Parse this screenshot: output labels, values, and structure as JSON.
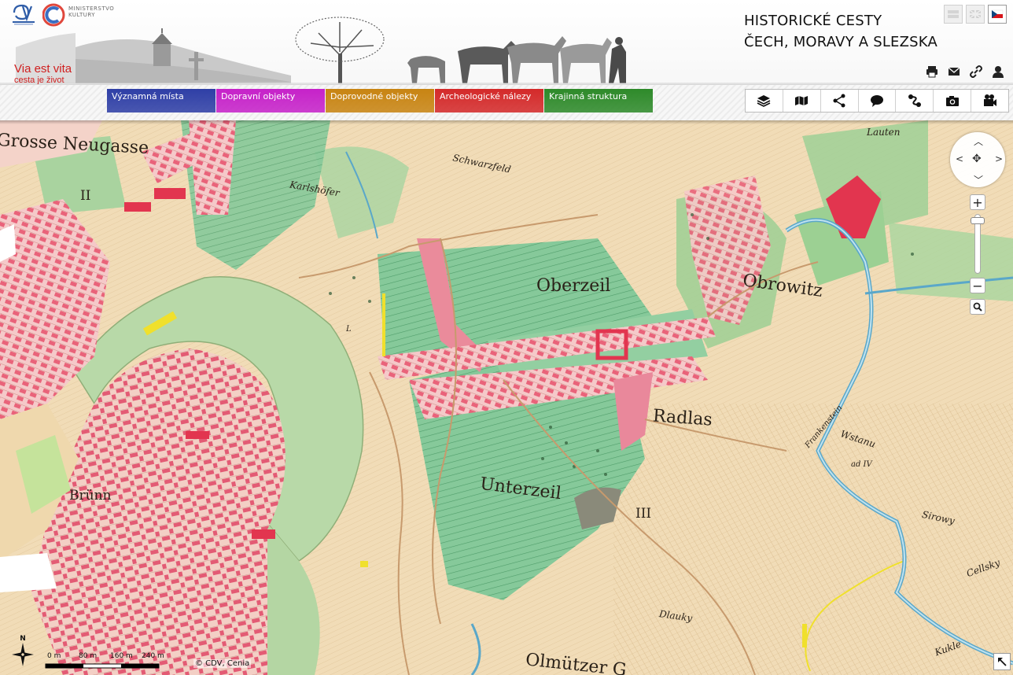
{
  "header": {
    "site_title_line1": "HISTORICKÉ CESTY",
    "site_title_line2": "ČECH, MORAVY A SLEZSKA",
    "brand_title": "Via est vita",
    "brand_subtitle": "cesta je život",
    "ministry_line1": "MINISTERSTVO",
    "ministry_line2": "KULTURY",
    "languages": [
      {
        "icon": "flag-neutral-icon",
        "active": false
      },
      {
        "icon": "flag-uk-icon",
        "active": false
      },
      {
        "icon": "flag-cz-icon",
        "active": true
      }
    ],
    "tools": [
      "print-icon",
      "mail-icon",
      "link-icon",
      "user-icon"
    ]
  },
  "categories": [
    {
      "label": "Významná místa",
      "color": "#2f3fa6"
    },
    {
      "label": "Dopravní objekty",
      "color": "#c622c9"
    },
    {
      "label": "Doprovodné objekty",
      "color": "#c88412"
    },
    {
      "label": "Archeologické nálezy",
      "color": "#d42a2a"
    },
    {
      "label": "Krajinná struktura",
      "color": "#2e8a2a"
    }
  ],
  "toolbar": [
    "layers-icon",
    "map-book-icon",
    "share-icon",
    "comment-icon",
    "route-icon",
    "camera-icon",
    "video-icon"
  ],
  "map": {
    "place_labels": [
      "Grosse Neugasse",
      "Karlshöfer",
      "Schwarzfeld",
      "Oberzeil",
      "Obrowitz",
      "Lauten",
      "Radlas",
      "Unterzeil",
      "Brünn",
      "Dlauky",
      "Olmützer G",
      "Wstanu",
      "ad IV",
      "Sirowy",
      "Cellsky",
      "Kukle",
      "Frankenstein"
    ],
    "section_numbers": [
      "II",
      "III",
      "L"
    ],
    "scale_labels": [
      "0 m",
      "80 m",
      "160 m",
      "240 m"
    ],
    "copyright": "© CDV, Cenia",
    "north_label": "N"
  }
}
